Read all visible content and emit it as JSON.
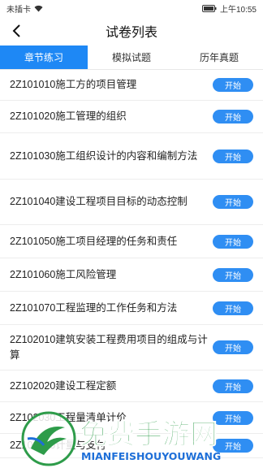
{
  "status_bar": {
    "carrier": "未插卡",
    "time": "上午10:55"
  },
  "header": {
    "title": "试卷列表"
  },
  "tabs": [
    {
      "label": "章节练习",
      "active": true
    },
    {
      "label": "模拟试题",
      "active": false
    },
    {
      "label": "历年真题",
      "active": false
    }
  ],
  "button_label": "开始",
  "items": [
    {
      "text": "2Z101010施工方的项目管理"
    },
    {
      "text": "2Z101020施工管理的组织"
    },
    {
      "text": "2Z101030施工组织设计的内容和编制方法"
    },
    {
      "text": "2Z101040建设工程项目目标的动态控制"
    },
    {
      "text": "2Z101050施工项目经理的任务和责任"
    },
    {
      "text": "2Z101060施工风险管理"
    },
    {
      "text": "2Z101070工程监理的工作任务和方法"
    },
    {
      "text": "2Z102010建筑安装工程费用项目的组成与计算"
    },
    {
      "text": "2Z102020建设工程定额"
    },
    {
      "text": "2Z102030工程量清单计价"
    },
    {
      "text": "2Z102040计量与支付"
    }
  ],
  "watermark": {
    "title": "免费手游网",
    "subtitle": "MIANFEISHOUYOUWANG"
  },
  "colors": {
    "accent": "#1e88f5",
    "button": "#2f8ef3"
  }
}
